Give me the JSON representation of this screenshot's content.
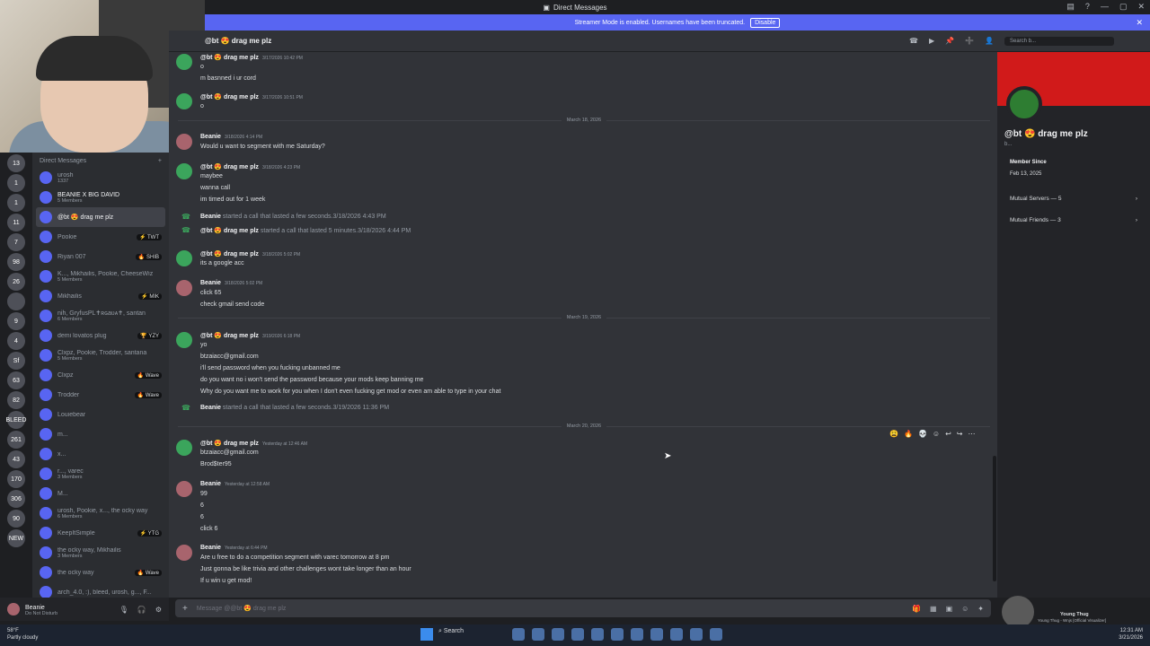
{
  "window": {
    "title": "Direct Messages"
  },
  "banner": {
    "text": "Streamer Mode is enabled. Usernames have been truncated.",
    "button": "Disable"
  },
  "servers": [
    "13",
    "1",
    "1",
    "11",
    "7",
    "98",
    "26",
    "",
    "9",
    "4",
    "Sf",
    "63",
    "82",
    "BLEED",
    "261",
    "43",
    "170",
    "306",
    "90",
    "NEW"
  ],
  "dm_list": {
    "header": "Direct Messages",
    "items": [
      {
        "name": "urosh",
        "sub": "1337",
        "badge": ""
      },
      {
        "name": "BEANIE X BIG DAVID",
        "sub": "5 Members",
        "badge": ""
      },
      {
        "name": "@bt 😍 drag me plz",
        "sub": "",
        "badge": ""
      },
      {
        "name": "Pookie",
        "sub": "",
        "badge": "⚡ TWT"
      },
      {
        "name": "Riyan 007",
        "sub": "",
        "badge": "🔥 SHIB"
      },
      {
        "name": "K..., Mikhailis, Pookie, CheeseWiz",
        "sub": "5 Members",
        "badge": ""
      },
      {
        "name": "Mikhailis",
        "sub": "",
        "badge": "⚡ MIK"
      },
      {
        "name": "nih, GryfusPL✝ʀɢaʋᴀ✝, santan",
        "sub": "6 Members",
        "badge": ""
      },
      {
        "name": "demi lovatos plug",
        "sub": "",
        "badge": "🏆 YZY"
      },
      {
        "name": "Clxpz, Pookie, Trodder, santana",
        "sub": "5 Members",
        "badge": ""
      },
      {
        "name": "Clxpz",
        "sub": "",
        "badge": "🔥 Wave"
      },
      {
        "name": "Trodder",
        "sub": "",
        "badge": "🔥 Wave"
      },
      {
        "name": "Louiebear",
        "sub": "",
        "badge": ""
      },
      {
        "name": "m...",
        "sub": "",
        "badge": ""
      },
      {
        "name": "x...",
        "sub": "",
        "badge": ""
      },
      {
        "name": "r..., varec",
        "sub": "3 Members",
        "badge": ""
      },
      {
        "name": "M...",
        "sub": "",
        "badge": ""
      },
      {
        "name": "urosh, Pookie, x..., the ocky way",
        "sub": "6 Members",
        "badge": ""
      },
      {
        "name": "KeepItSimple",
        "sub": "",
        "badge": "⚡ YTG"
      },
      {
        "name": "the ocky way, Mikhailis",
        "sub": "3 Members",
        "badge": ""
      },
      {
        "name": "the ocky way",
        "sub": "",
        "badge": "🔥 Wave"
      },
      {
        "name": "arch_4.0, :), bleed, urosh, g..., F...",
        "sub": "",
        "badge": ""
      }
    ]
  },
  "user": {
    "name": "Beanie",
    "status": "Do Not Disturb"
  },
  "chat": {
    "header": "@bt 😍 drag me plz",
    "search_placeholder": "Search b...",
    "composer_placeholder": "Message @@bt 😍 drag me plz",
    "messages": [
      {
        "who": "@bt 😍 drag me plz",
        "time": "3/17/2026 10:42 PM",
        "lines": [
          "o",
          "m basnned i ur cord"
        ]
      },
      {
        "who": "@bt 😍 drag me plz",
        "time": "3/17/2026 10:51 PM",
        "lines": [
          "o"
        ]
      },
      {
        "who": "Beanie",
        "time": "3/18/2026 4:14 PM",
        "lines": [
          "Would u want to segment with me Saturday?"
        ]
      },
      {
        "who": "@bt 😍 drag me plz",
        "time": "3/18/2026 4:23 PM",
        "lines": [
          "maybee",
          "wanna call",
          "im timed out for 1 week"
        ]
      },
      {
        "who": "@bt 😍 drag me plz",
        "time": "3/18/2026 5:02 PM",
        "lines": [
          "its a google acc"
        ]
      },
      {
        "who": "Beanie",
        "time": "3/18/2026 5:02 PM",
        "lines": [
          "click 65",
          "check gmail send code"
        ]
      },
      {
        "who": "@bt 😍 drag me plz",
        "time": "3/19/2026 6:18 PM",
        "lines": [
          "yo",
          "btzaiacc@gmail.com",
          "i'll send password when you fucking unbanned me",
          "do you want no i won't send the password because your mods keep banning me",
          "Why do you want me to work for you when I don't even fucking get mod or even am able to type in your chat"
        ]
      },
      {
        "who": "@bt 😍 drag me plz",
        "time": "Yesterday at 12:46 AM",
        "lines": [
          "btzaiacc@gmail.com",
          "Brod$ter95"
        ]
      },
      {
        "who": "Beanie",
        "time": "Yesterday at 12:58 AM",
        "lines": [
          "99",
          "6",
          "6",
          "click 6"
        ]
      },
      {
        "who": "Beanie",
        "time": "Yesterday at 6:44 PM",
        "lines": [
          "Are u free to do a competition segment with varec tomorrow at 8 pm",
          "Just gonna be like trivia and other challenges wont take longer than an hour",
          "If u win u get mod!"
        ]
      }
    ],
    "dividers": [
      "March 18, 2026",
      "March 19, 2026",
      "March 20, 2026"
    ],
    "calls": [
      {
        "who": "Beanie",
        "text": "started a call that lasted a few seconds.",
        "time": "3/18/2026 4:43 PM"
      },
      {
        "who": "@bt 😍 drag me plz",
        "text": "started a call that lasted 5 minutes.",
        "time": "3/18/2026 4:44 PM"
      },
      {
        "who": "Beanie",
        "text": "started a call that lasted a few seconds.",
        "time": "3/19/2026 11:36 PM"
      }
    ],
    "reactions": [
      "😩",
      "🔥",
      "💀"
    ]
  },
  "profile": {
    "name": "@bt 😍 drag me plz",
    "sub": "b...",
    "member_since_label": "Member Since",
    "member_since": "Feb 13, 2025",
    "mutual_servers": "Mutual Servers — 5",
    "mutual_friends": "Mutual Friends — 3"
  },
  "taskbar": {
    "weather_temp": "58°F",
    "weather_desc": "Partly cloudy",
    "search": "Search",
    "time": "12:31 AM",
    "date": "3/21/2026"
  },
  "media": {
    "title": "Young Thug",
    "subtitle": "Young Thug - Wnjs [Official Visualizer]"
  }
}
